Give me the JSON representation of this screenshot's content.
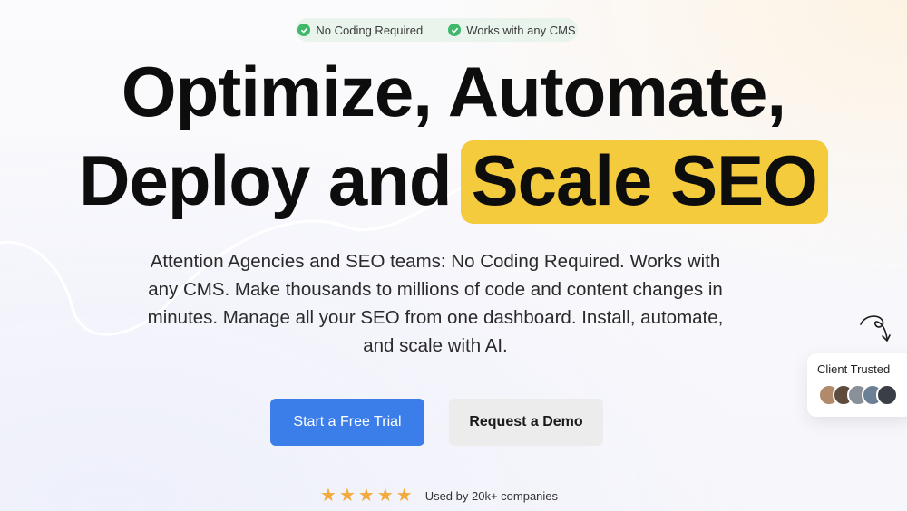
{
  "badges": [
    {
      "label": "No Coding Required",
      "icon": "check-circle-icon"
    },
    {
      "label": "Works with any CMS",
      "icon": "check-circle-icon"
    }
  ],
  "headline": {
    "line1": "Optimize, Automate,",
    "line2_prefix": "Deploy and",
    "line2_highlight": "Scale SEO"
  },
  "subheadline": "Attention Agencies and SEO teams: No Coding Required. Works with any CMS. Make thousands to millions of code and content changes in minutes. Manage all your SEO from one dashboard. Install, automate, and scale with AI.",
  "cta": {
    "primary": "Start a Free Trial",
    "secondary": "Request a Demo"
  },
  "rating": {
    "stars": 5,
    "text": "Used by 20k+ companies"
  },
  "trust_card": {
    "label": "Client Trusted",
    "avatar_count": 5
  },
  "colors": {
    "accent_blue": "#3b7de9",
    "highlight_yellow": "#f5cb3e",
    "check_green": "#3fb86b",
    "star_orange": "#f3a93b"
  }
}
